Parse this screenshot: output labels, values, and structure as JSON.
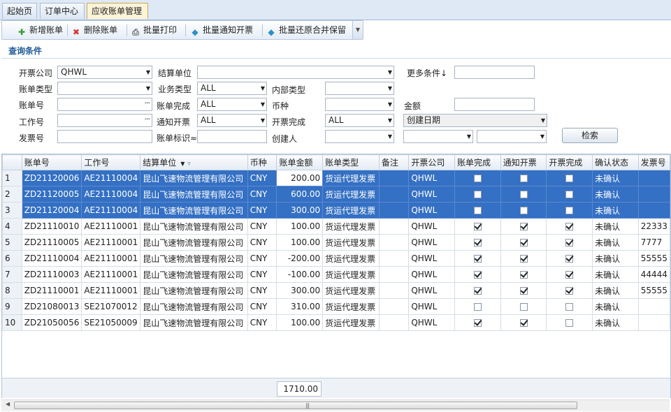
{
  "tabs": [
    {
      "label": "起始页",
      "active": false
    },
    {
      "label": "订单中心",
      "active": false
    },
    {
      "label": "应收账单管理",
      "active": true
    }
  ],
  "toolbar": {
    "add": "新增账单",
    "delete": "删除账单",
    "print": "批量打印",
    "notify_invoice": "批量通知开票",
    "restore": "批量还原合并保留"
  },
  "query": {
    "title": "查询条件",
    "labels": {
      "invoice_company": "开票公司",
      "settle_unit": "结算单位",
      "more": "更多条件↓",
      "bill_type": "账单类型",
      "biz_type": "业务类型",
      "internal_type": "内部类型",
      "bill_no": "账单号",
      "bill_done": "账单完成",
      "currency": "币种",
      "amount": "金额",
      "job_no": "工作号",
      "notify_invoice": "通知开票",
      "invoice_done": "开票完成",
      "invoice_no": "发票号",
      "bill_mark": "账单标识≈",
      "creator": "创建人"
    },
    "values": {
      "invoice_company": "QHWL",
      "biz_type": "ALL",
      "bill_done": "ALL",
      "notify_invoice": "ALL",
      "invoice_done": "ALL",
      "date_field": "创建日期"
    },
    "search_button": "检索"
  },
  "grid": {
    "columns": [
      "",
      "账单号",
      "工作号",
      "结算单位",
      "币种",
      "账单金额",
      "账单类型",
      "备注",
      "开票公司",
      "账单完成",
      "通知开票",
      "开票完成",
      "确认状态",
      "发票号"
    ],
    "rows": [
      {
        "n": "1",
        "bill": "ZD21120006",
        "job": "AE21110004",
        "unit": "昆山飞速物流管理有限公司",
        "cur": "CNY",
        "amt": "200.00",
        "type": "货运代理发票",
        "note": "",
        "co": "QHWL",
        "done": false,
        "notify": false,
        "inv": false,
        "status": "未确认",
        "invno": "",
        "selected": true
      },
      {
        "n": "2",
        "bill": "ZD21120005",
        "job": "AE21110004",
        "unit": "昆山飞速物流管理有限公司",
        "cur": "CNY",
        "amt": "600.00",
        "type": "货运代理发票",
        "note": "",
        "co": "QHWL",
        "done": false,
        "notify": false,
        "inv": false,
        "status": "未确认",
        "invno": "",
        "selected": true
      },
      {
        "n": "3",
        "bill": "ZD21120004",
        "job": "AE21110004",
        "unit": "昆山飞速物流管理有限公司",
        "cur": "CNY",
        "amt": "300.00",
        "type": "货运代理发票",
        "note": "",
        "co": "QHWL",
        "done": false,
        "notify": false,
        "inv": false,
        "status": "未确认",
        "invno": "",
        "selected": true
      },
      {
        "n": "4",
        "bill": "ZD21110010",
        "job": "AE21110001",
        "unit": "昆山飞速物流管理有限公司",
        "cur": "CNY",
        "amt": "100.00",
        "type": "货运代理发票",
        "note": "",
        "co": "QHWL",
        "done": true,
        "notify": true,
        "inv": true,
        "status": "未确认",
        "invno": "22333",
        "selected": false
      },
      {
        "n": "5",
        "bill": "ZD21110005",
        "job": "AE21110001",
        "unit": "昆山飞速物流管理有限公司",
        "cur": "CNY",
        "amt": "100.00",
        "type": "货运代理发票",
        "note": "",
        "co": "QHWL",
        "done": true,
        "notify": true,
        "inv": true,
        "status": "未确认",
        "invno": "7777",
        "selected": false
      },
      {
        "n": "6",
        "bill": "ZD21110004",
        "job": "AE21110001",
        "unit": "昆山飞速物流管理有限公司",
        "cur": "CNY",
        "amt": "-200.00",
        "type": "货运代理发票",
        "note": "",
        "co": "QHWL",
        "done": true,
        "notify": true,
        "inv": true,
        "status": "未确认",
        "invno": "55555",
        "selected": false
      },
      {
        "n": "7",
        "bill": "ZD21110003",
        "job": "AE21110001",
        "unit": "昆山飞速物流管理有限公司",
        "cur": "CNY",
        "amt": "-100.00",
        "type": "货运代理发票",
        "note": "",
        "co": "QHWL",
        "done": true,
        "notify": true,
        "inv": true,
        "status": "未确认",
        "invno": "44444",
        "selected": false
      },
      {
        "n": "8",
        "bill": "ZD21110001",
        "job": "AE21110001",
        "unit": "昆山飞速物流管理有限公司",
        "cur": "CNY",
        "amt": "300.00",
        "type": "货运代理发票",
        "note": "",
        "co": "QHWL",
        "done": true,
        "notify": true,
        "inv": true,
        "status": "未确认",
        "invno": "55555",
        "selected": false
      },
      {
        "n": "9",
        "bill": "ZD21080013",
        "job": "SE21070012",
        "unit": "昆山飞速物流管理有限公司",
        "cur": "CNY",
        "amt": "310.00",
        "type": "货运代理发票",
        "note": "",
        "co": "QHWL",
        "done": false,
        "notify": false,
        "inv": false,
        "status": "未确认",
        "invno": "",
        "selected": false
      },
      {
        "n": "10",
        "bill": "ZD21050056",
        "job": "SE21050009",
        "unit": "昆山飞速物流管理有限公司",
        "cur": "CNY",
        "amt": "100.00",
        "type": "货运代理发票",
        "note": "",
        "co": "QHWL",
        "done": true,
        "notify": true,
        "inv": false,
        "status": "未确认",
        "invno": "",
        "selected": false
      }
    ],
    "total": "1710.00"
  },
  "colors": {
    "selected_row": "#3470c4",
    "section_title": "#1f5a99"
  }
}
